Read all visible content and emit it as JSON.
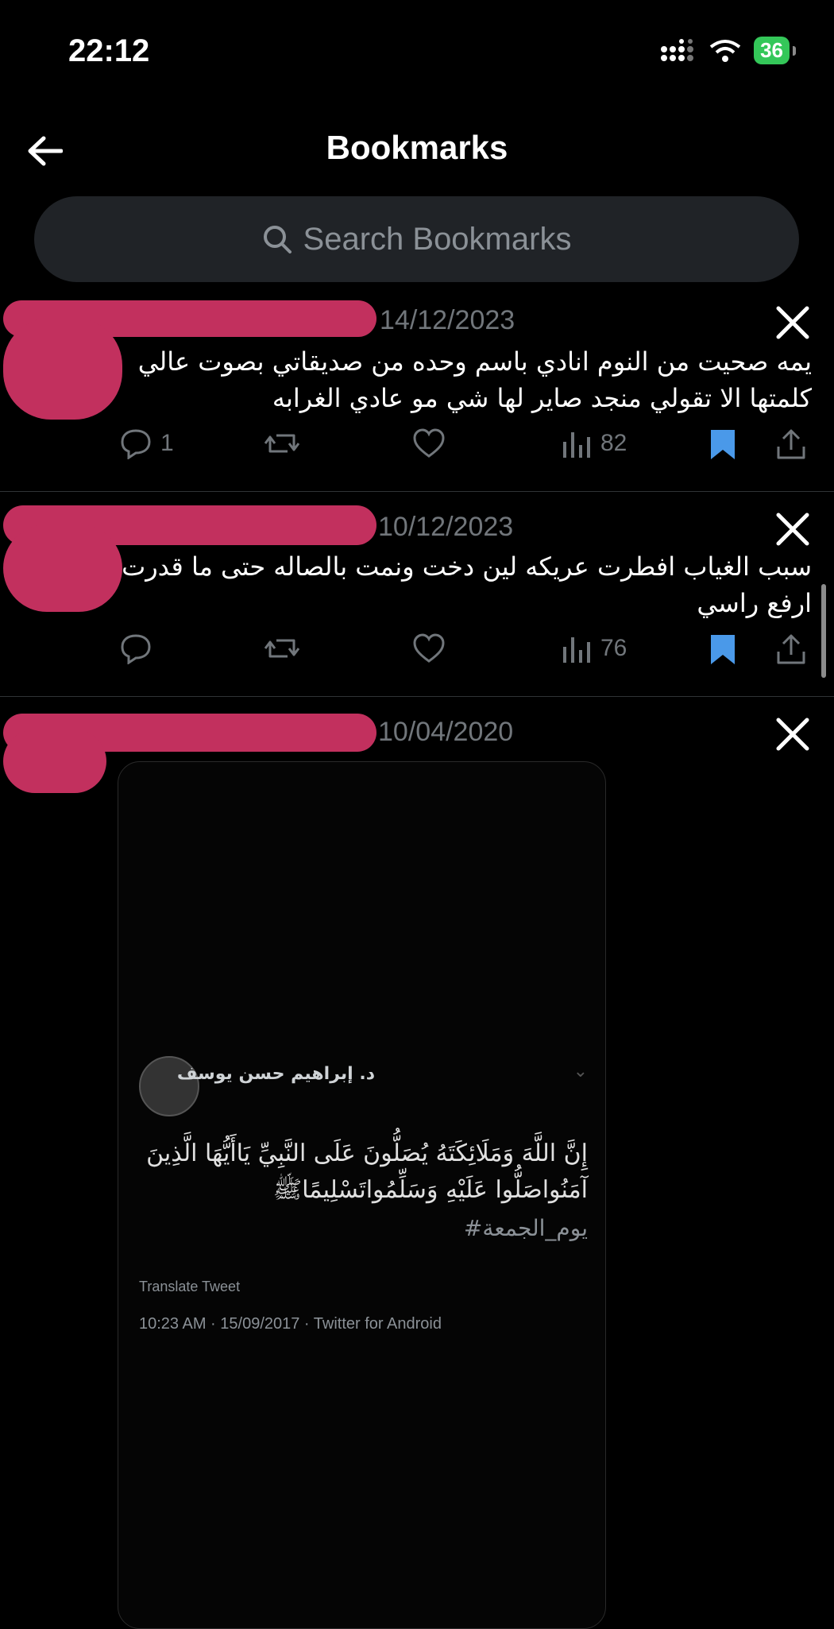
{
  "status_bar": {
    "time": "22:12",
    "battery": "36"
  },
  "header": {
    "title": "Bookmarks"
  },
  "search": {
    "placeholder": "Search Bookmarks"
  },
  "tweets": [
    {
      "date": "14/12/2023",
      "text_line1": "يمه صحيت من النوم انادي باسم وحده من صديقاتي بصوت عالي",
      "text_line2": "كلمتها الا تقولي منجد صاير لها شي مو عادي الغرابه",
      "replies": "1",
      "views": "82",
      "bookmarked": true
    },
    {
      "date": "10/12/2023",
      "text_line1": "سبب الغياب افطرت عريكه لين دخت ونمت بالصاله حتى ما قدرت",
      "text_line2": "ارفع راسي",
      "replies": "",
      "views": "76",
      "bookmarked": true
    },
    {
      "date": "10/04/2020",
      "embedded": {
        "author": "د. إبراهيم حسن يوسف",
        "verse_line1": "إِنَّ اللَّهَ وَمَلَائِكَتَهُ يُصَلُّونَ عَلَى النَّبِيِّ يَاأَيُّهَا الَّذِينَ",
        "verse_line2": "آمَنُواصَلُّوا عَلَيْهِ وَسَلِّمُواتَسْلِيمًاﷺ",
        "hashtag": "#يوم_الجمعة",
        "translate": "Translate Tweet",
        "meta": "10:23 AM · 15/09/2017 · Twitter for Android"
      }
    }
  ],
  "colors": {
    "bookmark": "#4a99e9",
    "redaction": "#c2305e",
    "background": "#000000"
  }
}
